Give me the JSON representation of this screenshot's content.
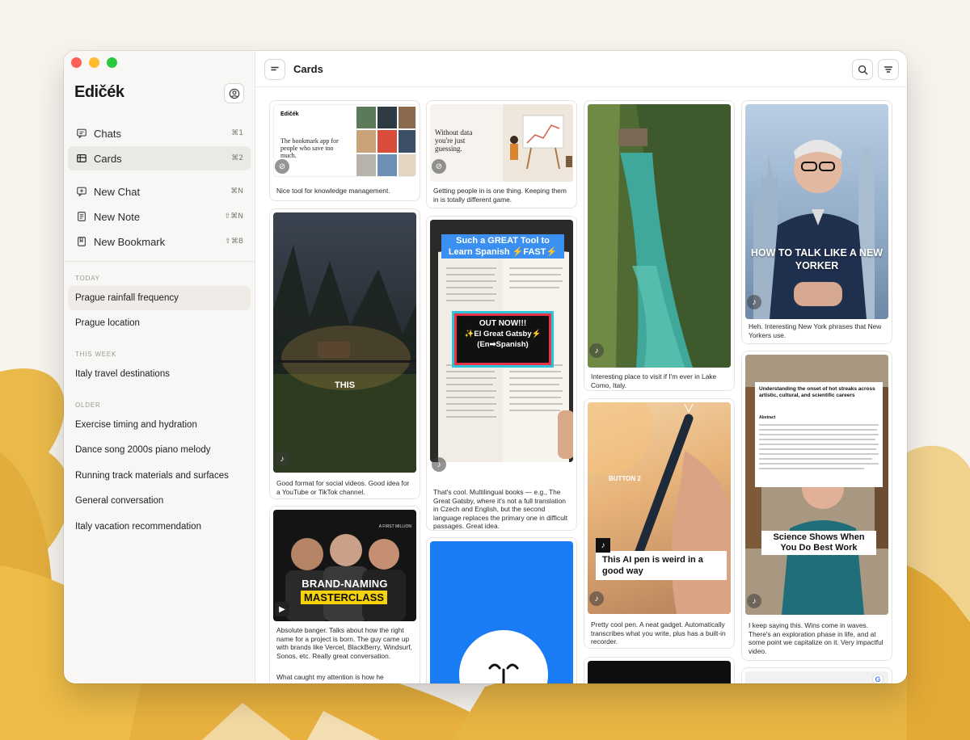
{
  "app": {
    "name": "Edicek",
    "brand_display": "Edičék"
  },
  "sidebar": {
    "nav": [
      {
        "label": "Chats",
        "shortcut": "⌘1",
        "icon": "chat-icon",
        "active": false
      },
      {
        "label": "Cards",
        "shortcut": "⌘2",
        "icon": "cards-icon",
        "active": true
      }
    ],
    "actions": [
      {
        "label": "New Chat",
        "shortcut": "⌘N",
        "icon": "new-chat-icon"
      },
      {
        "label": "New Note",
        "shortcut": "⇧⌘N",
        "icon": "new-note-icon"
      },
      {
        "label": "New Bookmark",
        "shortcut": "⇧⌘B",
        "icon": "new-bookmark-icon"
      }
    ],
    "sections": {
      "today": "TODAY",
      "this_week": "THIS WEEK",
      "older": "OLDER"
    },
    "history": {
      "today": [
        "Prague rainfall frequency",
        "Prague location"
      ],
      "this_week": [
        "Italy travel destinations"
      ],
      "older": [
        "Exercise timing and hydration",
        "Dance song 2000s piano melody",
        "Running track materials and surfaces",
        "General conversation",
        "Italy vacation recommendation"
      ]
    }
  },
  "header": {
    "title": "Cards",
    "search_icon": "search-icon",
    "filter_icon": "filter-icon",
    "sidebar_toggle_icon": "sidebar-toggle-icon"
  },
  "cards": {
    "c1": {
      "note": "Nice tool for knowledge management.",
      "thumb": {
        "logo": "Edičék",
        "headline": "The bookmark app for people who save too much.",
        "source_icon": "link-icon"
      }
    },
    "c2": {
      "note": "Getting people in is one thing. Keeping them in is totally different game.",
      "thumb": {
        "headline": "Without data you're just guessing.",
        "source_icon": "link-icon"
      }
    },
    "c3": {
      "note": "Good format for social videos. Good idea for a YouTube or TikTok channel.",
      "thumb": {
        "overlay": "THIS",
        "source_icon": "tiktok-icon"
      }
    },
    "c4": {
      "note": "Absolute banger. Talks about how the right name for a project is born. The guy came up with brands like Vercel, BlackBerry, Windsurf, Sonos, etc. Really great conversation.",
      "note2": "What caught my attention is how he",
      "thumb": {
        "line1": "BRAND-NAMING",
        "line2": "MASTERCLASS",
        "tag": "A FIRST MILLION",
        "source_icon": "youtube-icon"
      }
    },
    "c5": {
      "note": "That's cool. Multilingual books — e.g., The Great Gatsby, where it's not a full translation in Czech and English, but the second language replaces the primary one in difficult passages. Great idea.",
      "thumb": {
        "banner": "Such a GREAT Tool to Learn Spanish ⚡FAST⚡",
        "box_l1": "OUT NOW!!!",
        "box_l2": "✨El Great Gatsby⚡",
        "box_l3": "(En➡Spanish)",
        "source_icon": "tiktok-icon"
      }
    },
    "c6": {
      "thumb": {
        "source_icon": "app-logo-icon"
      }
    },
    "c7": {
      "note": "Interesting place to visit if I'm ever in Lake Como, Italy.",
      "thumb": {
        "source_icon": "tiktok-icon"
      }
    },
    "c8": {
      "note": "Pretty cool pen. A neat gadget. Automatically transcribes what you write, plus has a built-in recorder.",
      "thumb": {
        "label": "BUTTON 2",
        "caption": "This AI pen is weird in a good way",
        "source_icon": "tiktok-icon"
      }
    },
    "c10": {
      "note": "Heh. Interesting New York phrases that New Yorkers use.",
      "thumb": {
        "overlay": "HOW TO TALK LIKE A NEW YORKER",
        "source_icon": "tiktok-icon"
      }
    },
    "c11": {
      "note": "I keep saying this. Wins come in waves. There's an exploration phase in life, and at some point we capitalize on it. Very impactful video.",
      "thumb": {
        "paper_title": "Understanding the onset of hot streaks across artistic, cultural, and scientific careers",
        "paper_section": "Abstract",
        "overlay": "Science Shows When You Do Best Work",
        "source_icon": "tiktok-icon"
      }
    }
  },
  "colors": {
    "accent_blue": "#1a7cf5",
    "tiktok_red": "#e8334a",
    "brand_yellow": "#f5d20b"
  }
}
